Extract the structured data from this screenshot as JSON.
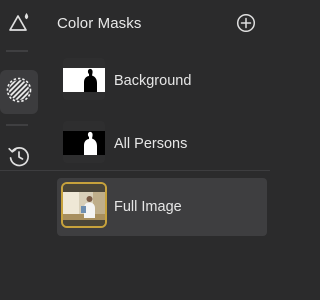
{
  "panel": {
    "title": "Color Masks",
    "add_icon": "plus-circle-icon"
  },
  "rail": {
    "tools": [
      {
        "icon": "triangle-droplet-icon",
        "active": false
      },
      {
        "icon": "hatched-circle-icon",
        "active": true
      },
      {
        "icon": "history-clock-icon",
        "active": false
      }
    ]
  },
  "masks": [
    {
      "label": "Background",
      "selected": false
    },
    {
      "label": "All Persons",
      "selected": false
    },
    {
      "label": "Full Image",
      "selected": true
    }
  ],
  "colors": {
    "background": "#2b2b2c",
    "selected_row": "#3e3e40",
    "selection_border": "#c7a23c",
    "text": "#e6e6e6"
  }
}
